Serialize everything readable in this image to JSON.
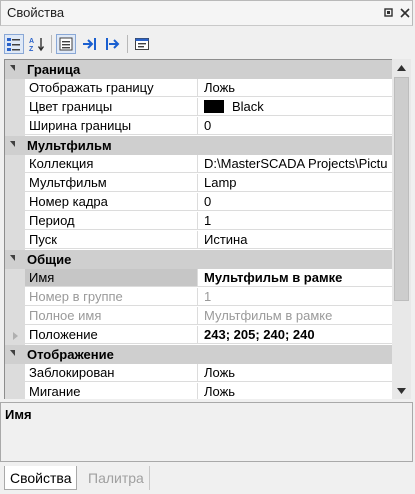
{
  "window": {
    "title": "Свойства"
  },
  "grid": {
    "categories": [
      {
        "label": "Граница",
        "rows": [
          {
            "name": "Отображать границу",
            "value": "Ложь"
          },
          {
            "name": "Цвет границы",
            "value": "Black",
            "swatch": "#000000"
          },
          {
            "name": "Ширина границы",
            "value": "0"
          }
        ]
      },
      {
        "label": "Мультфильм",
        "rows": [
          {
            "name": "Коллекция",
            "value": "D:\\MasterSCADA Projects\\Pictu"
          },
          {
            "name": "Мультфильм",
            "value": "Lamp"
          },
          {
            "name": "Номер кадра",
            "value": "0"
          },
          {
            "name": "Период",
            "value": "1"
          },
          {
            "name": "Пуск",
            "value": "Истина"
          }
        ]
      },
      {
        "label": "Общие",
        "rows": [
          {
            "name": "Имя",
            "value": "Мультфильм в рамке",
            "selected": true,
            "bold": true
          },
          {
            "name": "Номер в группе",
            "value": "1",
            "disabled": true
          },
          {
            "name": "Полное имя",
            "value": "Мультфильм в рамке",
            "disabled": true
          },
          {
            "name": "Положение",
            "value": "243; 205; 240; 240",
            "bold": true,
            "expandable": true
          }
        ]
      },
      {
        "label": "Отображение",
        "rows": [
          {
            "name": "Заблокирован",
            "value": "Ложь"
          },
          {
            "name": "Мигание",
            "value": "Ложь"
          }
        ]
      }
    ]
  },
  "description": {
    "title": "Имя"
  },
  "tabs": [
    {
      "label": "Свойства",
      "active": true
    },
    {
      "label": "Палитра",
      "active": false
    }
  ],
  "icons": {
    "categorized": "categorized-icon",
    "alphabetical": "sort-alphabetical-icon",
    "properties": "properties-icon",
    "events": "events-icon",
    "bindings": "bindings-icon",
    "property-pages": "property-pages-icon"
  },
  "colors": {
    "category_bg": "#cfcfcf",
    "disabled_text": "#9a9a9a",
    "accent": "#1a5fd0"
  }
}
